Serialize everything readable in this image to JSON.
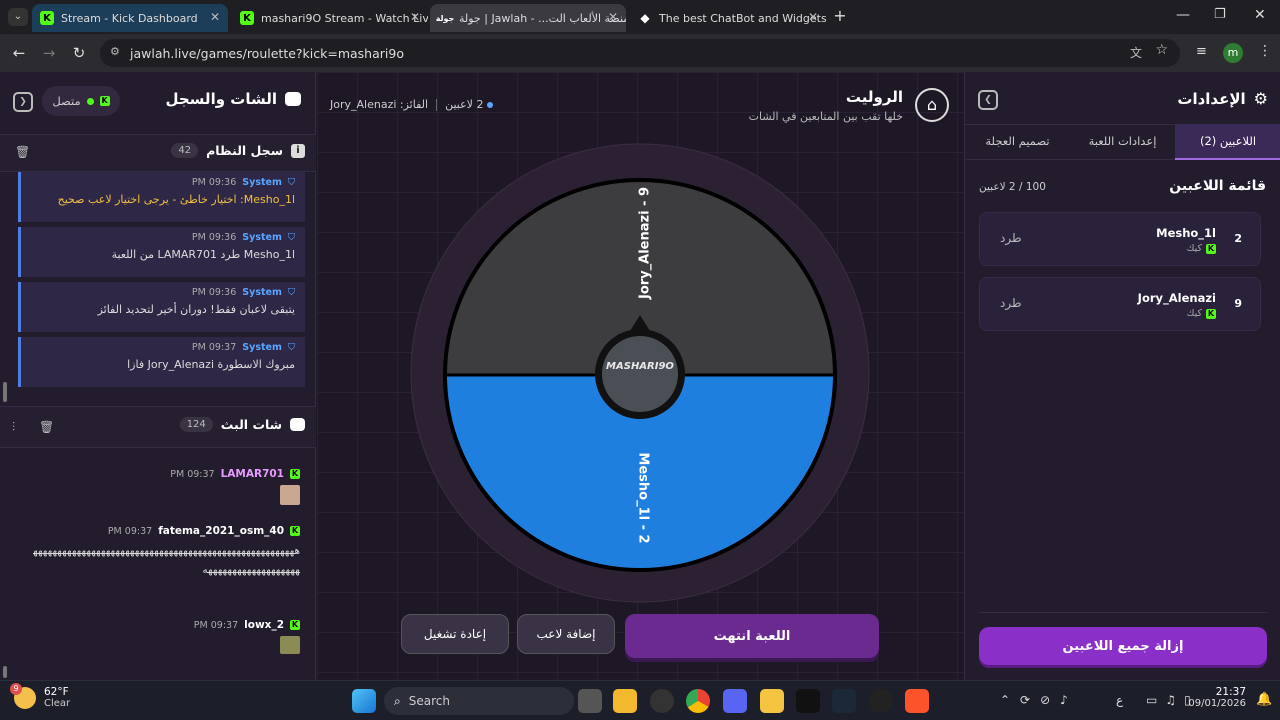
{
  "browser": {
    "tabs": [
      {
        "title": "Stream - Kick Dashboard",
        "active": false
      },
      {
        "title": "mashari9O Stream - Watch Live",
        "active": false
      },
      {
        "title": "منصة الألعاب الت... - Jawlah | جولة",
        "active": true
      },
      {
        "title": "The best ChatBot and Widgets",
        "active": false
      }
    ],
    "url": "jawlah.live/games/roulette?kick=mashari9o",
    "profile_initial": "m"
  },
  "left": {
    "title": "الشات والسجل",
    "status": "متصل",
    "log": {
      "title": "سجل النظام",
      "count": "42",
      "messages": [
        {
          "sender": "System",
          "time": "09:36 PM",
          "text": "Mesho_1l: اختيار خاطئ - يرجى اختيار لاعب صحيح",
          "color": "#f0c040"
        },
        {
          "sender": "System",
          "time": "09:36 PM",
          "text": "Mesho_1l طرد LAMAR701 من اللعبة",
          "color": "#dddddd"
        },
        {
          "sender": "System",
          "time": "09:36 PM",
          "text": "يتبقى لاعبان فقط! دوران أخير لتحديد الفائز",
          "color": "#dddddd"
        },
        {
          "sender": "System",
          "time": "09:37 PM",
          "text": "مبروك الاسطورة Jory_Alenazi فازا",
          "color": "#dddddd"
        }
      ]
    },
    "chat": {
      "title": "شات البث",
      "count": "124",
      "messages": [
        {
          "user": "LAMAR701",
          "time": "09:37 PM",
          "text": "",
          "color": "#e89bff"
        },
        {
          "user": "fatema_2021_osm_40",
          "time": "09:37 PM",
          "text": "ههههههههههههههههههههههههههههههههههههههههههههههههههههههههههههههههههههههههههه",
          "color": "#ffffff"
        },
        {
          "user": "lowx_2",
          "time": "09:37 PM",
          "text": "",
          "color": "#ffffff"
        }
      ]
    }
  },
  "center": {
    "title": "الروليت",
    "subtitle": "خلها تقب بين المتابعين في الشات",
    "players_count": "2 لاعبين",
    "winner": "الفائز: Jory_Alenazi",
    "logo_text": "MASHARI9O",
    "wheel": [
      {
        "label": "Jory_Alenazi - 9",
        "color": "#3d3d3f"
      },
      {
        "label": "Mesho_1l - 2",
        "color": "#1f7fdf"
      }
    ],
    "buttons": {
      "game_over": "اللعبة انتهت",
      "add_player": "إضافة لاعب",
      "restart": "إعادة تشغيل"
    }
  },
  "right": {
    "title": "الإعدادات",
    "tabs": [
      "اللاعبين (2)",
      "إعدادات اللعبة",
      "تصميم العجلة"
    ],
    "list_title": "قائمة اللاعبين",
    "list_count": "100 / 2 لاعبين",
    "players": [
      {
        "num": "2",
        "name": "Mesho_1l",
        "platform": "كيك",
        "action": "طرد"
      },
      {
        "num": "9",
        "name": "Jory_Alenazi",
        "platform": "كيك",
        "action": "طرد"
      }
    ],
    "remove_all": "إزالة جميع اللاعبين"
  },
  "taskbar": {
    "weather_temp": "62°F",
    "weather_desc": "Clear",
    "search": "Search",
    "lang": "ع",
    "time": "21:37",
    "date": "09/01/2026"
  },
  "colors": {
    "accent_purple": "#8b2fc9",
    "kick_green": "#53fc18",
    "system_blue": "#58a6ff"
  }
}
